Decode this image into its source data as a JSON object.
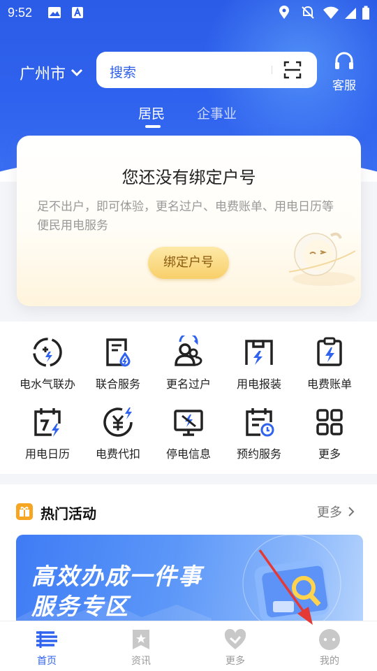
{
  "status_bar": {
    "time": "9:52"
  },
  "header": {
    "city": "广州市",
    "search_placeholder": "搜索",
    "service_label": "客服"
  },
  "tabs": [
    {
      "label": "居民",
      "active": true
    },
    {
      "label": "企事业",
      "active": false
    }
  ],
  "bind_card": {
    "title": "您还没有绑定户号",
    "description": "足不出户，即可体验，更名过户、电费账单、用电日历等便民用电服务",
    "button": "绑定户号"
  },
  "services": [
    {
      "label": "电水气联办",
      "icon": "water-gas-electric-icon"
    },
    {
      "label": "联合服务",
      "icon": "joint-service-icon"
    },
    {
      "label": "更名过户",
      "icon": "transfer-users-icon"
    },
    {
      "label": "用电报装",
      "icon": "power-install-icon"
    },
    {
      "label": "电费账单",
      "icon": "bill-icon"
    },
    {
      "label": "用电日历",
      "icon": "calendar-icon"
    },
    {
      "label": "电费代扣",
      "icon": "yuan-deduct-icon"
    },
    {
      "label": "停电信息",
      "icon": "outage-monitor-icon"
    },
    {
      "label": "预约服务",
      "icon": "appointment-icon"
    },
    {
      "label": "更多",
      "icon": "grid-more-icon"
    }
  ],
  "hot_activities": {
    "title": "热门活动",
    "more": "更多",
    "banner_line1": "高效办成一件事",
    "banner_line2": "服务专区"
  },
  "tab_bar": [
    {
      "label": "首页",
      "active": true,
      "icon": "home-icon"
    },
    {
      "label": "资讯",
      "active": false,
      "icon": "news-icon"
    },
    {
      "label": "更多",
      "active": false,
      "icon": "more-heart-icon"
    },
    {
      "label": "我的",
      "active": false,
      "icon": "profile-icon"
    }
  ],
  "colors": {
    "primary": "#2f62ee",
    "accent_gold": "#f8cf6a",
    "arrow": "#e53935"
  }
}
